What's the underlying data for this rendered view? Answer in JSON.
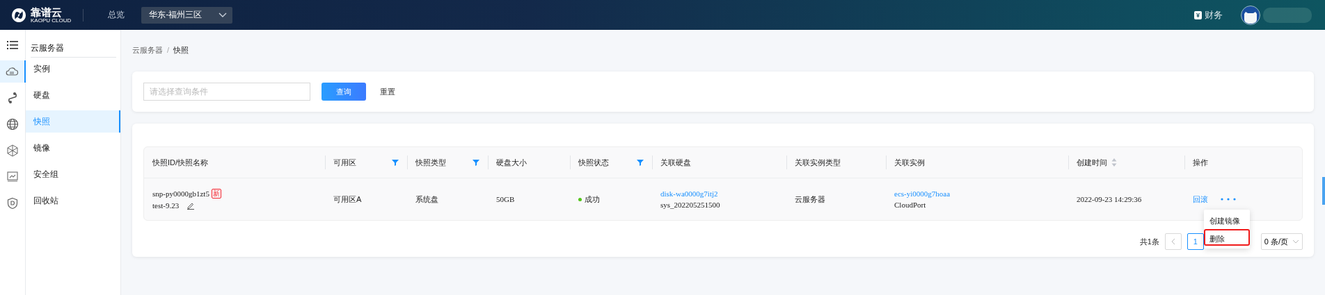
{
  "topbar": {
    "brand": "靠谱云",
    "brand_sub": "KAOPU CLOUD",
    "nav": "总览",
    "region": "华东-福州三区",
    "finance_icon": "¥",
    "finance": "财务"
  },
  "rail": [
    {
      "selected": true
    },
    {
      "selected": false
    },
    {
      "selected": false
    },
    {
      "selected": false
    },
    {
      "selected": false
    },
    {
      "selected": false
    }
  ],
  "sidebar": {
    "title": "云服务器",
    "items": [
      {
        "label": "实例",
        "selected": false
      },
      {
        "label": "硬盘",
        "selected": false
      },
      {
        "label": "快照",
        "selected": true
      },
      {
        "label": "镜像",
        "selected": false
      },
      {
        "label": "安全组",
        "selected": false
      },
      {
        "label": "回收站",
        "selected": false
      }
    ]
  },
  "breadcrumb": {
    "items": [
      "云服务器",
      "快照"
    ],
    "separator": "/"
  },
  "search": {
    "placeholder": "请选择查询条件",
    "query_button": "查询",
    "reset_button": "重置"
  },
  "table": {
    "columns": [
      {
        "label": "快照ID/快照名称",
        "kind": "plain"
      },
      {
        "label": "可用区",
        "kind": "filter"
      },
      {
        "label": "快照类型",
        "kind": "filter"
      },
      {
        "label": "硬盘大小",
        "kind": "plain"
      },
      {
        "label": "快照状态",
        "kind": "filter"
      },
      {
        "label": "关联硬盘",
        "kind": "plain"
      },
      {
        "label": "关联实例类型",
        "kind": "plain"
      },
      {
        "label": "关联实例",
        "kind": "plain"
      },
      {
        "label": "创建时间",
        "kind": "sort"
      },
      {
        "label": "操作",
        "kind": "plain"
      }
    ],
    "rows": [
      {
        "id": "snp-py0000gb1zt5",
        "badge": "新",
        "name": "test-9.23",
        "zone": "可用区A",
        "type": "系统盘",
        "size": "50GB",
        "status": {
          "label": "成功",
          "color": "#52c41a"
        },
        "disk": {
          "id": "disk-wa0000g7itj2",
          "name": "sys_202205251500"
        },
        "instance_type": "云服务器",
        "instance": {
          "id": "ecs-yi0000g7hoaa",
          "name": "CloudPort"
        },
        "created": "2022-09-23 14:29:36",
        "action": "回滚"
      }
    ]
  },
  "row_menu": [
    {
      "label": "创建镜像",
      "highlighted": false
    },
    {
      "label": "删除",
      "highlighted": true
    }
  ],
  "pagination": {
    "total": "共1条",
    "page": "1",
    "page_size": "0 条/页"
  }
}
